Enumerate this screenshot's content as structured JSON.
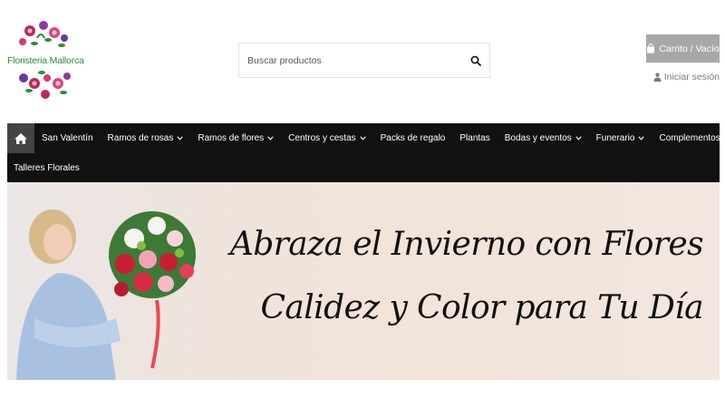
{
  "header": {
    "logo_text": "Floristeria Mallorca",
    "search": {
      "placeholder": "Buscar productos"
    },
    "cart_label": "Carrito / Vacío",
    "login_label": "Iniciar sesión"
  },
  "nav": {
    "items": [
      {
        "label": "San Valentín",
        "dropdown": false
      },
      {
        "label": "Ramos de rosas",
        "dropdown": true
      },
      {
        "label": "Ramos de flores",
        "dropdown": true
      },
      {
        "label": "Centros y cestas",
        "dropdown": true
      },
      {
        "label": "Packs de regalo",
        "dropdown": false
      },
      {
        "label": "Plantas",
        "dropdown": false
      },
      {
        "label": "Bodas y eventos",
        "dropdown": true
      },
      {
        "label": "Funerario",
        "dropdown": true
      },
      {
        "label": "Complementos",
        "dropdown": true
      }
    ],
    "row2_item": "Talleres Florales"
  },
  "banner": {
    "line1": "Abraza el Invierno con Flores",
    "line2": "Calidez y Color para Tu Día"
  },
  "colors": {
    "nav_bg": "#111111",
    "home_bg": "#444444",
    "cart_bg": "#a8a8a8",
    "logo_green": "#2e8b3a"
  }
}
